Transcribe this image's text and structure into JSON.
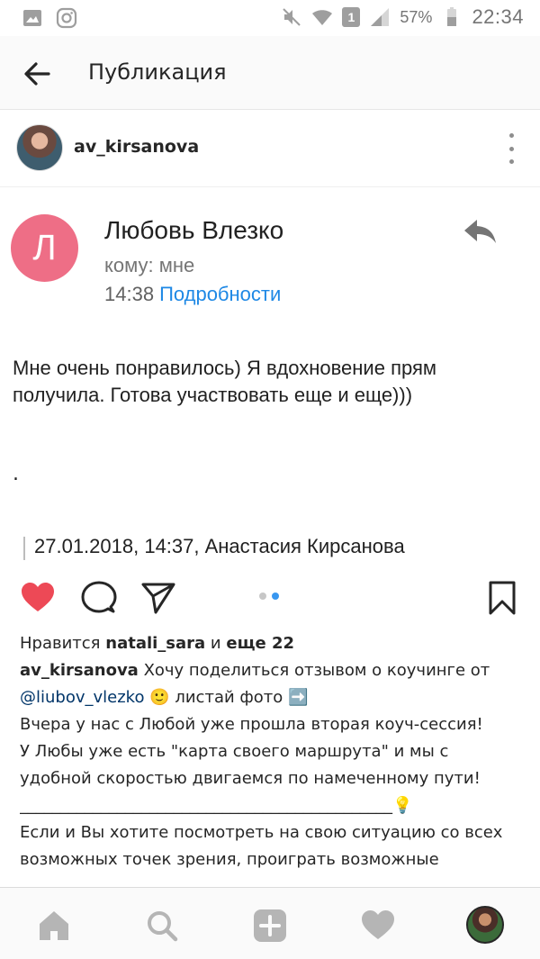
{
  "status_bar": {
    "battery_percent": "57%",
    "time": "22:34",
    "sim_label": "1",
    "icons": [
      "image-icon",
      "instagram-icon",
      "mute-icon",
      "wifi-icon",
      "sim-icon",
      "signal-icon",
      "battery-icon"
    ]
  },
  "app_bar": {
    "title": "Публикация"
  },
  "post": {
    "username": "av_kirsanova"
  },
  "email": {
    "avatar_letter": "Л",
    "avatar_color": "#ee6e86",
    "sender": "Любовь Влезко",
    "recipient": "кому: мне",
    "time": "14:38",
    "details_link": "Подробности",
    "body_line1": "Мне очень понравилось) Я вдохновение прям",
    "body_line2": "получила. Готова участвовать еще и еще)))",
    "dot": ".",
    "quote": "27.01.2018, 14:37, Анастасия Кирсанова"
  },
  "actions": {
    "like_color": "#ed4956",
    "pager_active_color": "#3897f0"
  },
  "caption": {
    "likes_prefix": "Нравится",
    "likes_user": "natali_sara",
    "likes_middle": "и",
    "likes_rest": "еще 22",
    "author": "av_kirsanova",
    "line1_text": "Хочу поделиться отзывом о коучинге от",
    "mention": "@liubov_vlezko",
    "line2_rest": "🙂 листай фото ➡️",
    "line3": "Вчера у нас с Любой уже прошла вторая коуч-сессия!",
    "line4": "У Любы уже есть \"карта своего маршрута\" и мы с",
    "line5": "удобной скоростью двигаемся по намеченному пути!",
    "line6": "______________________________________________💡",
    "line7": "Если и Вы хотите посмотреть на свою ситуацию со всех",
    "line8": "возможных точек зрения, проиграть возможные"
  }
}
